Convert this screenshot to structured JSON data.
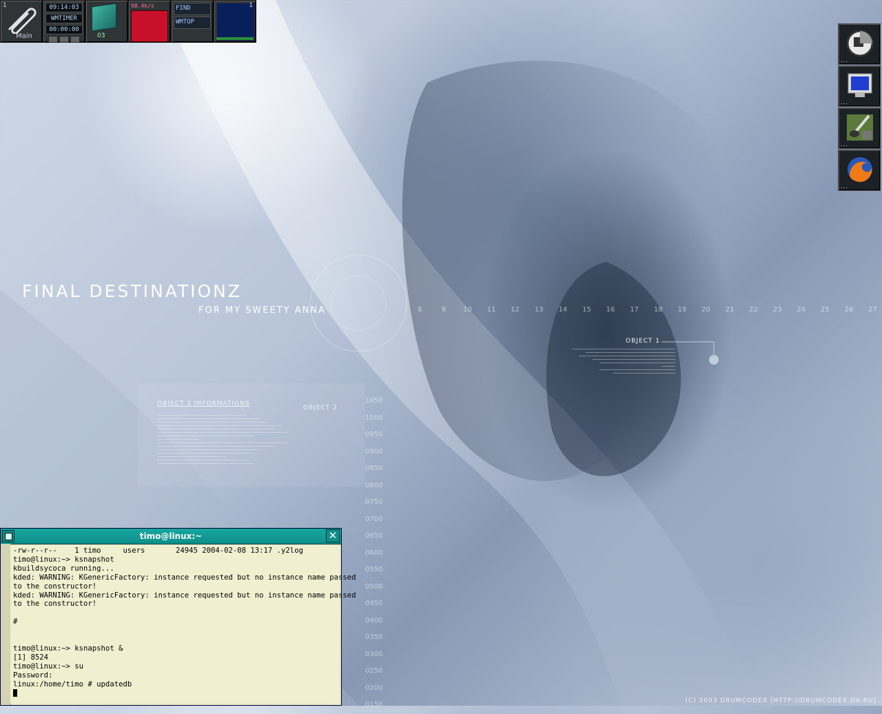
{
  "wallpaper": {
    "title": "FINAL DESTINATIONZ",
    "subtitle": "FOR MY SWEETY ANNA",
    "object1_label": "OBJECT 1",
    "object2_label": "OBJECT 2",
    "object2_info_label": "OBJECT 2 INFORMATIONS",
    "copyright": "(C) 2003 DRUMCODEX [HTTP://DRUMCODEX.DA.RU]",
    "ruler_ticks": [
      "8",
      "9",
      "10",
      "11",
      "12",
      "13",
      "14",
      "15",
      "16",
      "17",
      "18",
      "19",
      "20",
      "21",
      "22",
      "23",
      "24",
      "25",
      "26",
      "27"
    ],
    "vertical_ticks": [
      "1050",
      "1000",
      "0950",
      "0900",
      "0850",
      "0800",
      "0750",
      "0700",
      "0650",
      "0600",
      "0550",
      "0500",
      "0450",
      "0400",
      "0350",
      "0300",
      "0250",
      "0200",
      "0150"
    ]
  },
  "dock": {
    "main": {
      "workspace": "1",
      "label": "Main"
    },
    "timer": {
      "time": "09:14:03",
      "name": "WMTIMER",
      "counter": "00:00:00"
    },
    "cube": {
      "label": "03"
    },
    "net": {
      "rate": "98.4k/s"
    },
    "find": {
      "label1": "FIND",
      "label2": "WMTOP"
    },
    "pager": {
      "num": "1"
    }
  },
  "launcher": {
    "items": [
      {
        "icon": "kde-logo-icon",
        "dots": "..."
      },
      {
        "icon": "monitor-icon",
        "dots": "..."
      },
      {
        "icon": "paint-brush-icon",
        "dots": "..."
      },
      {
        "icon": "firefox-icon",
        "dots": "..."
      }
    ]
  },
  "terminal": {
    "title": "timo@linux:~",
    "lines": [
      "-rw-r--r--    1 timo     users       24945 2004-02-08 13:17 .y2log",
      "timo@linux:~> ksnapshot",
      "kbuildsycoca running...",
      "kded: WARNING: KGenericFactory: instance requested but no instance name passed",
      "to the constructor!",
      "kded: WARNING: KGenericFactory: instance requested but no instance name passed",
      "to the constructor!",
      "",
      "#",
      "",
      "",
      "timo@linux:~> ksnapshot &",
      "[1] 8524",
      "timo@linux:~> su",
      "Password:",
      "linux:/home/timo # updatedb"
    ]
  },
  "colors": {
    "titlebar": "#0e8f89",
    "terminal_bg": "#f0f0d0",
    "dock_bg": "#2f3436"
  }
}
